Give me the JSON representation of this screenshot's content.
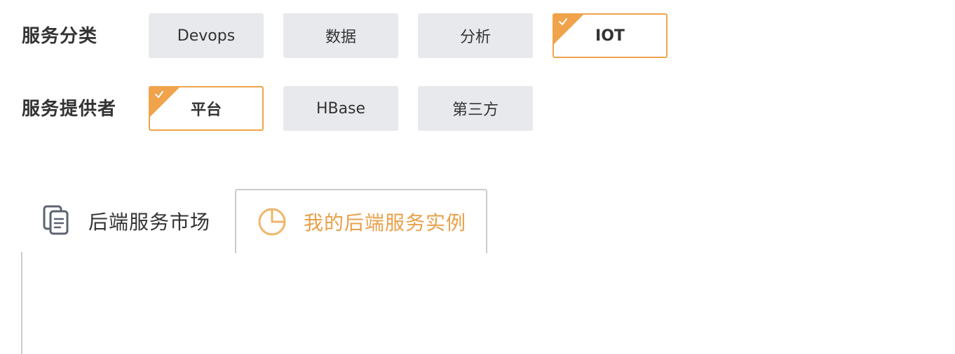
{
  "filters": {
    "category": {
      "label": "服务分类",
      "options": [
        "Devops",
        "数据",
        "分析",
        "IOT"
      ],
      "selected": "IOT"
    },
    "provider": {
      "label": "服务提供者",
      "options": [
        "平台",
        "HBase",
        "第三方"
      ],
      "selected": "平台"
    }
  },
  "tabs": [
    {
      "label": "后端服务市场",
      "icon": "document-icon",
      "active": false
    },
    {
      "label": "我的后端服务实例",
      "icon": "pie-chart-icon",
      "active": true
    }
  ],
  "colors": {
    "accent": "#f0a34a",
    "active_tab_text": "#e9a049",
    "chip_bg": "#e8e9ec",
    "border": "#cccccc"
  }
}
